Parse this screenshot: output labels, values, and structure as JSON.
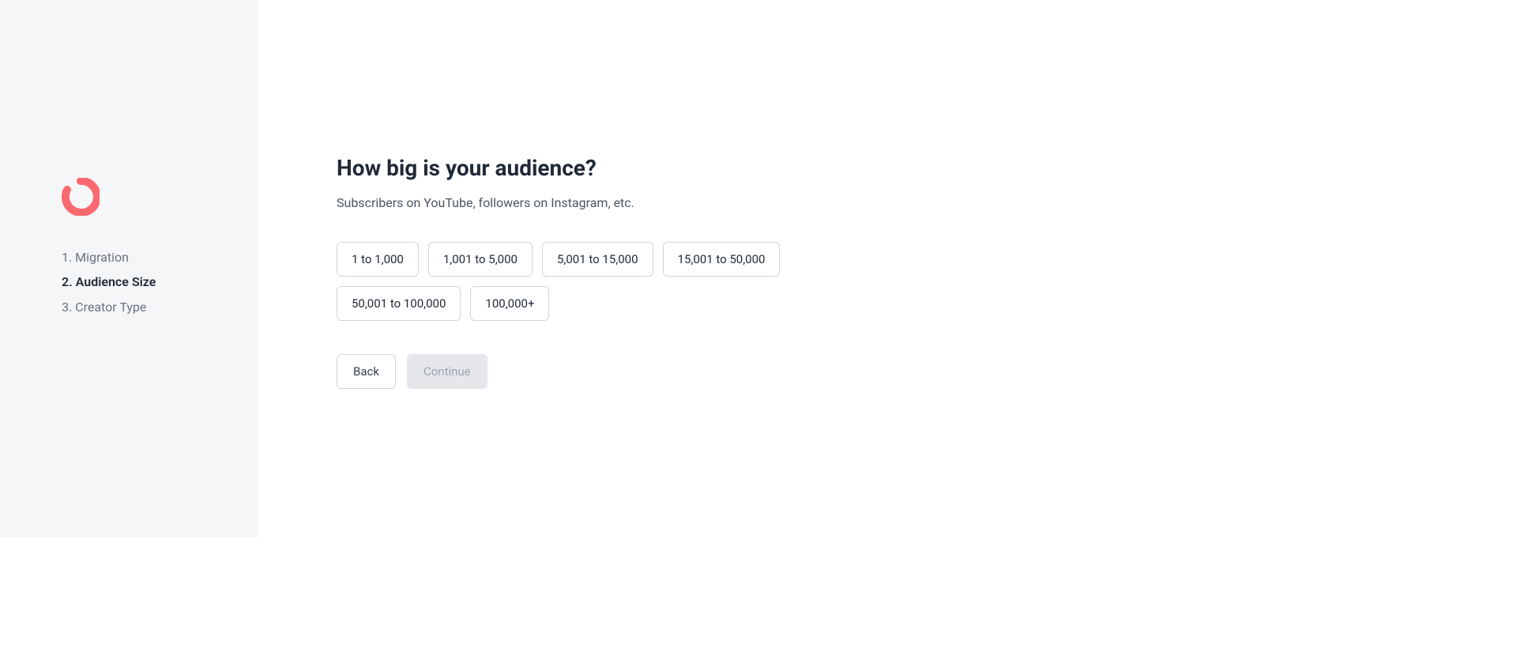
{
  "sidebar": {
    "steps": [
      {
        "label": "1. Migration",
        "active": false
      },
      {
        "label": "2. Audience Size",
        "active": true
      },
      {
        "label": "3. Creator Type",
        "active": false
      }
    ]
  },
  "main": {
    "title": "How big is your audience?",
    "subtitle": "Subscribers on YouTube, followers on Instagram, etc.",
    "options": [
      "1 to 1,000",
      "1,001 to 5,000",
      "5,001 to 15,000",
      "15,001 to 50,000",
      "50,001 to 100,000",
      "100,000+"
    ],
    "back_label": "Back",
    "continue_label": "Continue"
  },
  "colors": {
    "accent": "#FB6970"
  }
}
